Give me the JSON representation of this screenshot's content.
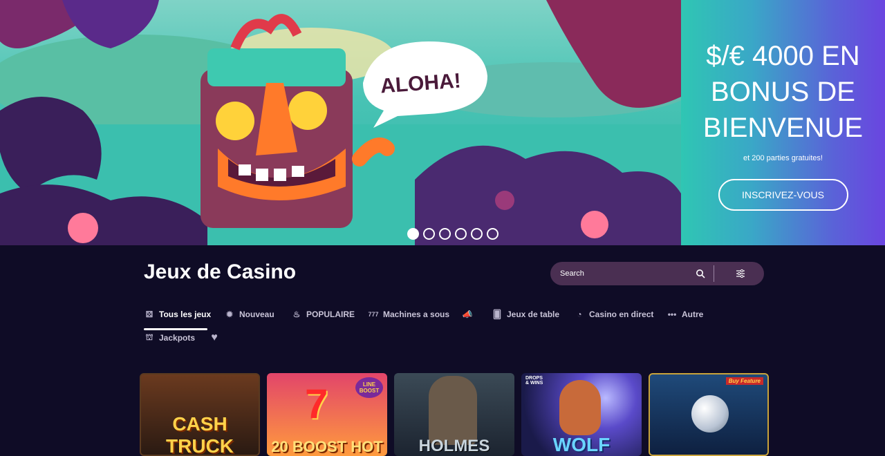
{
  "hero": {
    "speech": "ALOHA!",
    "promo_title": "$/€ 4000 EN\nBONUS DE\nBIENVENUE",
    "promo_sub": "et 200 parties gratuites!",
    "cta": "INSCRIVEZ-VOUS",
    "slides": 6,
    "active_slide": 1
  },
  "page": {
    "title": "Jeux de Casino"
  },
  "search": {
    "placeholder": "Search"
  },
  "tabs": [
    {
      "label": "Tous les jeux",
      "icon": "dice-icon",
      "active": true
    },
    {
      "label": "Nouveau",
      "icon": "new-badge-icon"
    },
    {
      "label": "POPULAIRE",
      "icon": "fire-icon"
    },
    {
      "label": "Machines a sous",
      "icon": "slot-777-icon"
    },
    {
      "label": "",
      "icon": "megaphone-icon"
    },
    {
      "label": "Jeux de table",
      "icon": "cards-icon"
    },
    {
      "label": "Casino en direct",
      "icon": "live-dealer-icon"
    },
    {
      "label": "Autre",
      "icon": "more-dots-icon"
    },
    {
      "label": "Jackpots",
      "icon": "jackpot-siren-icon"
    },
    {
      "label": "",
      "icon": "heart-icon"
    }
  ],
  "games": [
    {
      "title": "CASH TRUCK",
      "colors": [
        "#6b3a1f",
        "#2a1a12"
      ]
    },
    {
      "title": "20 BOOST HOT",
      "badge": "LINE BOOST",
      "colors": [
        "#e2456a",
        "#ff9b3d"
      ]
    },
    {
      "title": "HOLMES",
      "colors": [
        "#3b4a56",
        "#1c2430"
      ]
    },
    {
      "title": "WOLF",
      "badge": "DROPS & WINS",
      "colors": [
        "#3a3a9a",
        "#1a1a4a"
      ]
    },
    {
      "title": "",
      "badge": "Buy Feature",
      "colors": [
        "#1f4a7a",
        "#0e2040"
      ]
    }
  ]
}
